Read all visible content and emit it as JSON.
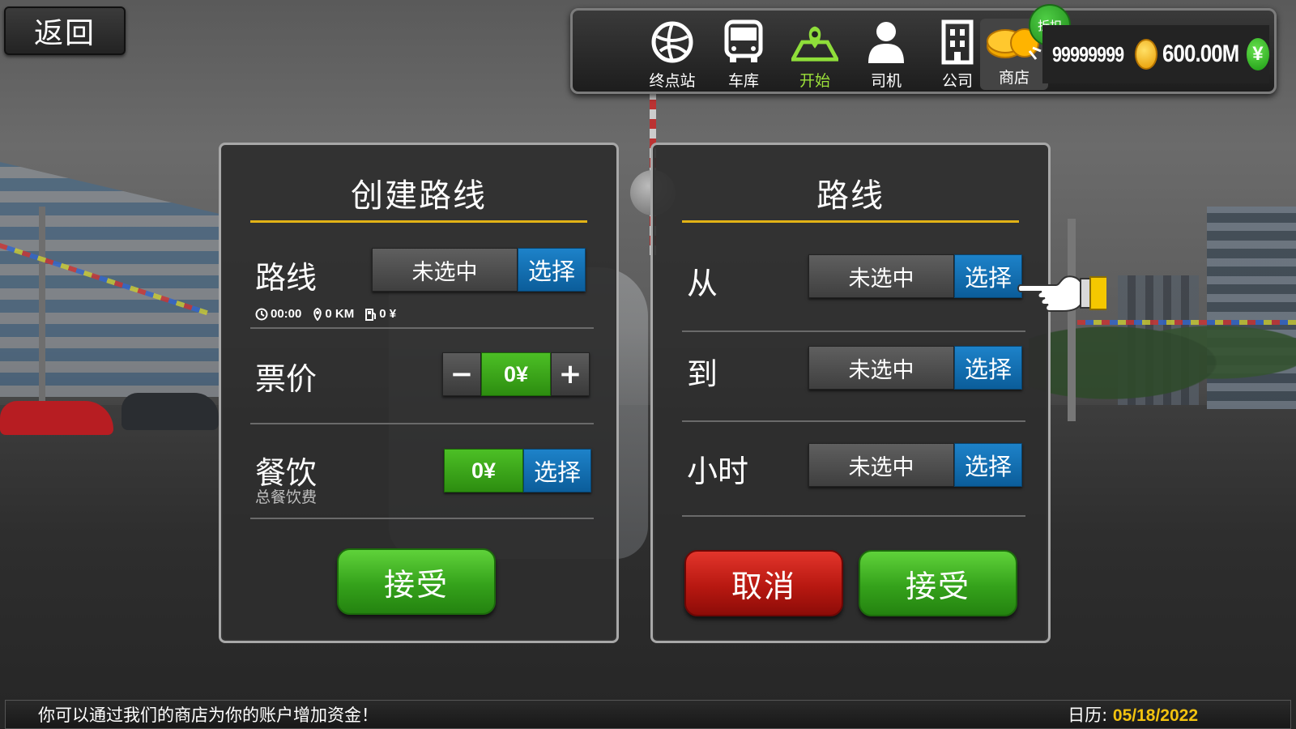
{
  "back_button": {
    "label": "返回"
  },
  "nav": {
    "items": [
      {
        "label": "终点站",
        "icon": "globe-icon"
      },
      {
        "label": "车库",
        "icon": "bus-icon"
      },
      {
        "label": "开始",
        "icon": "map-pin-icon",
        "active": true
      },
      {
        "label": "司机",
        "icon": "driver-icon"
      },
      {
        "label": "公司",
        "icon": "building-icon"
      }
    ],
    "shop": {
      "label": "商店",
      "icon": "coins-icon",
      "badge": "折扣"
    },
    "currency": {
      "coins": "99999999",
      "money": "600.00M",
      "money_icon": "¥"
    }
  },
  "create_route_panel": {
    "title": "创建路线",
    "route": {
      "label": "路线",
      "value": "未选中",
      "button": "选择"
    },
    "route_info": {
      "time": "00:00",
      "distance": "0 KM",
      "cost": "0 ¥"
    },
    "fare": {
      "label": "票价",
      "value": "0¥",
      "minus": "−",
      "plus": "+"
    },
    "catering": {
      "label": "餐饮",
      "sublabel": "总餐饮费",
      "value": "0¥",
      "button": "选择"
    },
    "accept_button": "接受"
  },
  "route_panel": {
    "title": "路线",
    "from": {
      "label": "从",
      "value": "未选中",
      "button": "选择"
    },
    "to": {
      "label": "到",
      "value": "未选中",
      "button": "选择"
    },
    "hour": {
      "label": "小时",
      "value": "未选中",
      "button": "选择"
    },
    "cancel_button": "取消",
    "accept_button": "接受"
  },
  "bottom_bar": {
    "ticker": "你可以通过我们的商店为你的账户增加资金！",
    "calendar_label": "日历: ",
    "calendar_date": "05/18/2022"
  },
  "colors": {
    "accent_rule": "#e2b316",
    "select_blue": "#0b5d9a",
    "green": "#35a21b",
    "red": "#b81811",
    "date_yellow": "#f2c20f"
  }
}
